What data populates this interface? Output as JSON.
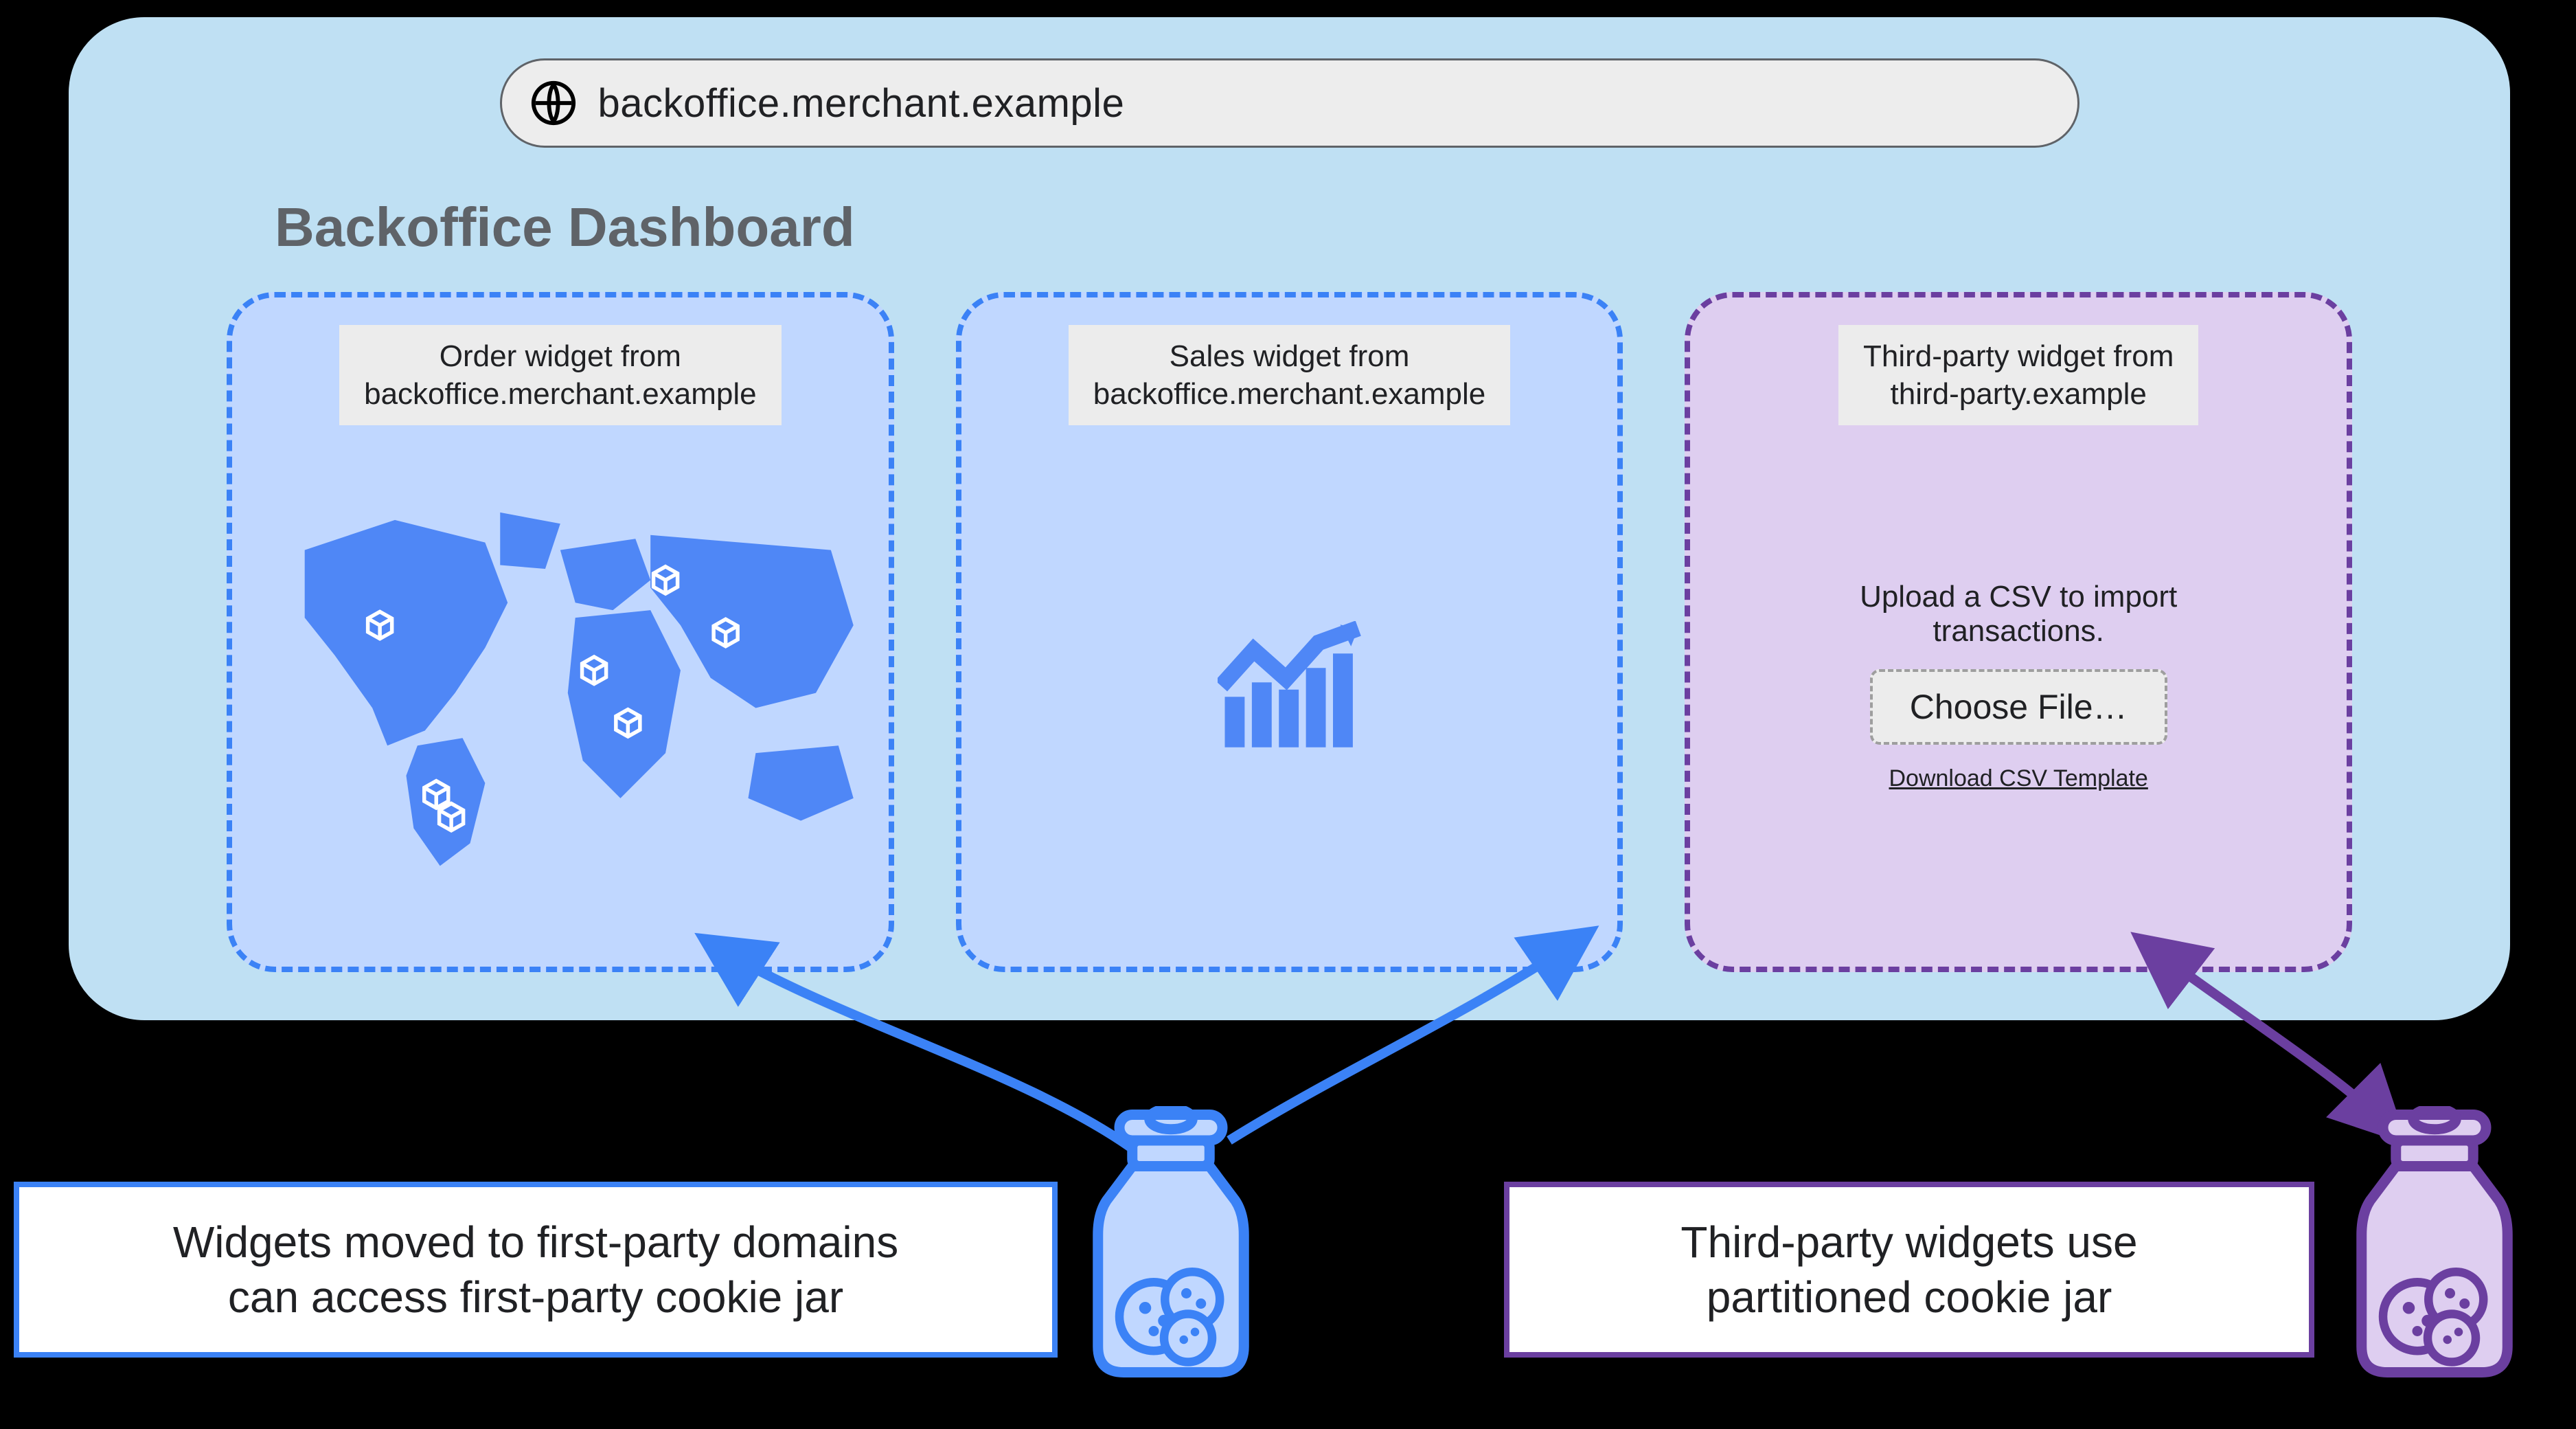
{
  "url": "backoffice.merchant.example",
  "page_title": "Backoffice Dashboard",
  "widgets": {
    "order": {
      "label": "Order widget from\nbackoffice.merchant.example"
    },
    "sales": {
      "label": "Sales widget from\nbackoffice.merchant.example"
    },
    "third": {
      "label": "Third-party widget from\nthird-party.example",
      "prompt": "Upload a CSV to import\ntransactions.",
      "choose_file": "Choose File…",
      "download_link": "Download CSV Template"
    }
  },
  "captions": {
    "first_party": "Widgets moved to first-party domains\ncan access first-party cookie jar",
    "third_party": "Third-party widgets use\npartitioned cookie jar"
  },
  "colors": {
    "blue": "#3b82f6",
    "purple": "#6b3fa0",
    "browser_bg": "#bfe0f3",
    "widget_blue_bg": "#c0d7ff",
    "widget_purple_bg": "#decef0"
  }
}
